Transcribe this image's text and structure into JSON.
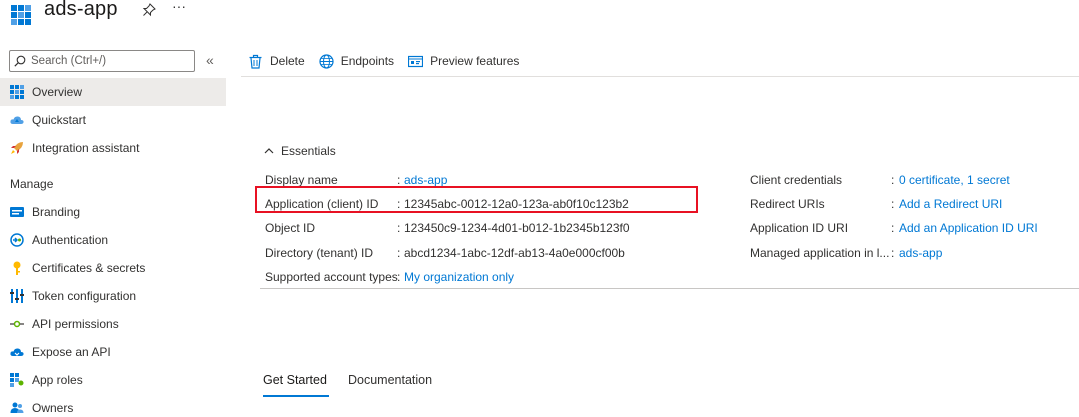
{
  "header": {
    "title": "ads-app",
    "more": "···"
  },
  "sidebar": {
    "search_placeholder": "Search (Ctrl+/)",
    "collapse": "«",
    "section_manage": "Manage",
    "items": [
      {
        "label": "Overview",
        "icon": "overview-grid-icon",
        "selected": true
      },
      {
        "label": "Quickstart",
        "icon": "cloud-quickstart-icon"
      },
      {
        "label": "Integration assistant",
        "icon": "rocket-icon"
      },
      {
        "label": "Branding",
        "icon": "branding-icon"
      },
      {
        "label": "Authentication",
        "icon": "authentication-icon"
      },
      {
        "label": "Certificates & secrets",
        "icon": "key-icon"
      },
      {
        "label": "Token configuration",
        "icon": "token-bars-icon"
      },
      {
        "label": "API permissions",
        "icon": "api-permissions-icon"
      },
      {
        "label": "Expose an API",
        "icon": "cloud-api-icon"
      },
      {
        "label": "App roles",
        "icon": "app-roles-icon"
      },
      {
        "label": "Owners",
        "icon": "owners-icon"
      }
    ]
  },
  "toolbar": {
    "delete": "Delete",
    "endpoints": "Endpoints",
    "preview": "Preview features"
  },
  "essentials": {
    "heading": "Essentials",
    "left": [
      {
        "label": "Display name",
        "value": "ads-app",
        "link": true
      },
      {
        "label": "Application (client) ID",
        "value": "12345abc-0012-12a0-123a-ab0f10c123b2",
        "link": false
      },
      {
        "label": "Object ID",
        "value": "123450c9-1234-4d01-b012-1b2345b123f0",
        "link": false
      },
      {
        "label": "Directory (tenant) ID",
        "value": "abcd1234-1abc-12df-ab13-4a0e000cf00b",
        "link": false
      },
      {
        "label": "Supported account types",
        "value": "My organization only",
        "link": true
      }
    ],
    "right": [
      {
        "label": "Client credentials",
        "value": "0 certificate, 1 secret",
        "link": true
      },
      {
        "label": "Redirect URIs",
        "value": "Add a Redirect URI",
        "link": true
      },
      {
        "label": "Application ID URI",
        "value": "Add an Application ID URI",
        "link": true
      },
      {
        "label": "Managed application in l...",
        "value": "ads-app",
        "link": true
      }
    ]
  },
  "tabs": [
    "Get Started",
    "Documentation"
  ],
  "colors": {
    "accent": "#0078d4",
    "highlight": "#e81123",
    "selected_bg": "#edebe9"
  }
}
